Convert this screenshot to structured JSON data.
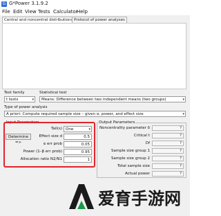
{
  "window": {
    "title": "G*Power 3.1.9.2",
    "icon": "gpower-app-icon"
  },
  "menu": [
    "File",
    "Edit",
    "View",
    "Tests",
    "Calculator",
    "Help"
  ],
  "tabs": [
    "Central and noncentral distributions",
    "Protocol of power analyses"
  ],
  "test_family": {
    "label": "Test family",
    "value": "t tests"
  },
  "statistical_test": {
    "label": "Statistical test",
    "value": "Means: Difference between two independent means (two groups)"
  },
  "power_analysis": {
    "label": "Type of power analysis",
    "value": "A priori: Compute required sample size – given α, power, and effect size"
  },
  "input": {
    "title": "Input Parameters",
    "determine_button": "Determine",
    "params": [
      {
        "label": "Tail(s)",
        "value": "One"
      },
      {
        "label": "Effect size d",
        "value": "0.5"
      },
      {
        "label": "α err prob",
        "value": "0.05"
      },
      {
        "label": "Power (1–β err prob)",
        "value": "0.95"
      },
      {
        "label": "Allocation ratio N2/N1",
        "value": "1"
      }
    ]
  },
  "output": {
    "title": "Output Parameters",
    "params": [
      {
        "label": "Noncentrality parameter δ",
        "value": "?"
      },
      {
        "label": "Critical t",
        "value": "?"
      },
      {
        "label": "Df",
        "value": "?"
      },
      {
        "label": "Sample size group 1",
        "value": "?"
      },
      {
        "label": "Sample size group 2",
        "value": "?"
      },
      {
        "label": "Total sample size",
        "value": "?"
      },
      {
        "label": "Actual power",
        "value": "?"
      }
    ]
  },
  "watermark": {
    "text": "爱育手游网",
    "color": "#1a1a1a"
  },
  "colors": {
    "highlight": "#e0242b"
  }
}
